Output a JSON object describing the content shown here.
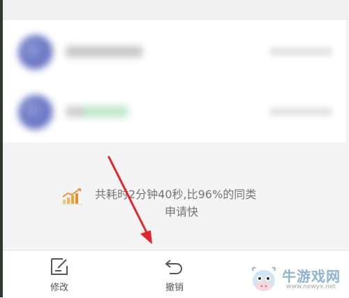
{
  "summary": {
    "line1": "共耗时2分钟40秒,比96%的同类",
    "line2": "申请快"
  },
  "toolbar": {
    "edit_label": "修改",
    "undo_label": "撤销"
  },
  "watermark": {
    "title": "牛游戏网",
    "url": "www.newyx.net"
  },
  "colors": {
    "arrow": "#e0262c",
    "accent_chart": "#f2a23a",
    "text_muted": "#747474"
  },
  "icons": {
    "summary": "bar-chart-trend-icon",
    "edit": "edit-note-icon",
    "undo": "undo-icon",
    "watermark": "cow-mascot-logo"
  }
}
